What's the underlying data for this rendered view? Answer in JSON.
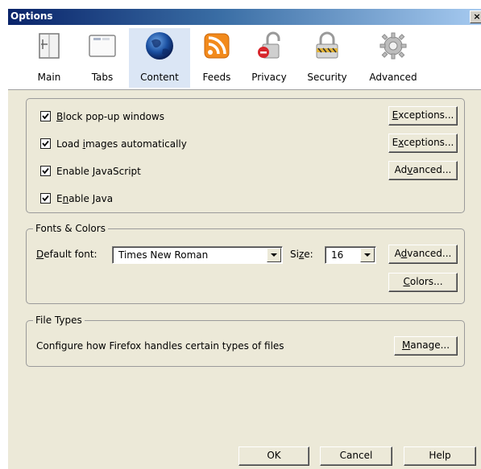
{
  "window": {
    "title": "Options",
    "close_glyph": "×"
  },
  "toolbar": {
    "items": [
      {
        "label": "Main",
        "icon": "main-window-icon"
      },
      {
        "label": "Tabs",
        "icon": "tabs-icon"
      },
      {
        "label": "Content",
        "icon": "globe-icon",
        "selected": true
      },
      {
        "label": "Feeds",
        "icon": "rss-feed-icon"
      },
      {
        "label": "Privacy",
        "icon": "privacy-lock-icon"
      },
      {
        "label": "Security",
        "icon": "security-padlock-icon"
      },
      {
        "label": "Advanced",
        "icon": "gear-icon"
      }
    ]
  },
  "content": {
    "checkboxes": [
      {
        "pre": "",
        "key": "B",
        "post": "lock pop-up windows",
        "checked": true
      },
      {
        "pre": "Load ",
        "key": "i",
        "post": "mages automatically",
        "checked": true
      },
      {
        "pre": "Enable ",
        "key": "J",
        "post": "avaScript",
        "checked": true
      },
      {
        "pre": "E",
        "key": "n",
        "post": "able Java",
        "checked": true
      }
    ],
    "buttons": {
      "exceptions1": {
        "pre": "",
        "key": "E",
        "post": "xceptions..."
      },
      "exceptions2": {
        "pre": "E",
        "key": "x",
        "post": "ceptions..."
      },
      "advanced_js": {
        "pre": "Ad",
        "key": "v",
        "post": "anced..."
      }
    }
  },
  "fonts_colors": {
    "legend": "Fonts & Colors",
    "default_font_label": {
      "pre": "",
      "key": "D",
      "post": "efault font:"
    },
    "default_font_value": "Times New Roman",
    "size_label": {
      "pre": "Si",
      "key": "z",
      "post": "e:"
    },
    "size_value": "16",
    "advanced_button": {
      "pre": "A",
      "key": "d",
      "post": "vanced..."
    },
    "colors_button": {
      "pre": "",
      "key": "C",
      "post": "olors..."
    }
  },
  "file_types": {
    "legend": "File Types",
    "description": "Configure how Firefox handles certain types of files",
    "manage_button": {
      "pre": "",
      "key": "M",
      "post": "anage..."
    }
  },
  "footer": {
    "ok": "OK",
    "cancel": "Cancel",
    "help": "Help"
  }
}
